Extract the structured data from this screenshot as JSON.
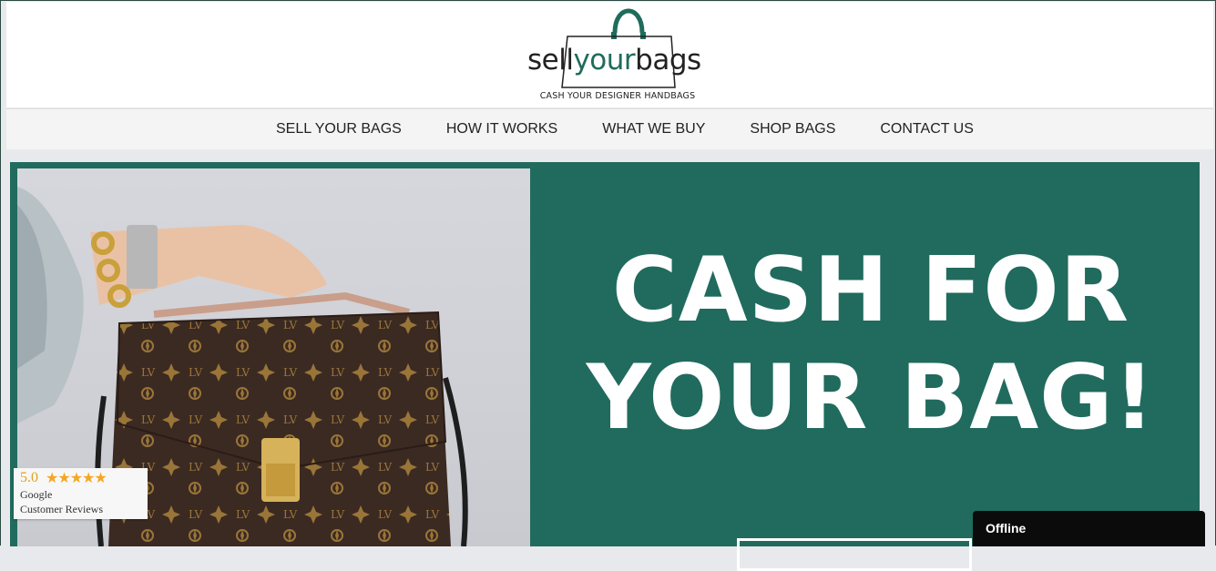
{
  "brand": {
    "word_part1": "sell",
    "word_part2": "your",
    "word_part3": "bags",
    "tagline": "CASH YOUR DESIGNER HANDBAGS",
    "accent_color": "#1f6c5c"
  },
  "nav": {
    "items": [
      {
        "label": "SELL YOUR BAGS"
      },
      {
        "label": "HOW IT WORKS"
      },
      {
        "label": "WHAT WE BUY"
      },
      {
        "label": "SHOP BAGS"
      },
      {
        "label": "CONTACT US"
      }
    ]
  },
  "hero": {
    "headline_line1": "CASH FOR",
    "headline_line2": "YOUR BAG!",
    "background_color": "#206b5e"
  },
  "reviews": {
    "score": "5.0",
    "stars": "★★★★★",
    "source": "Google",
    "label": "Customer Reviews"
  },
  "chat": {
    "status": "Offline"
  }
}
